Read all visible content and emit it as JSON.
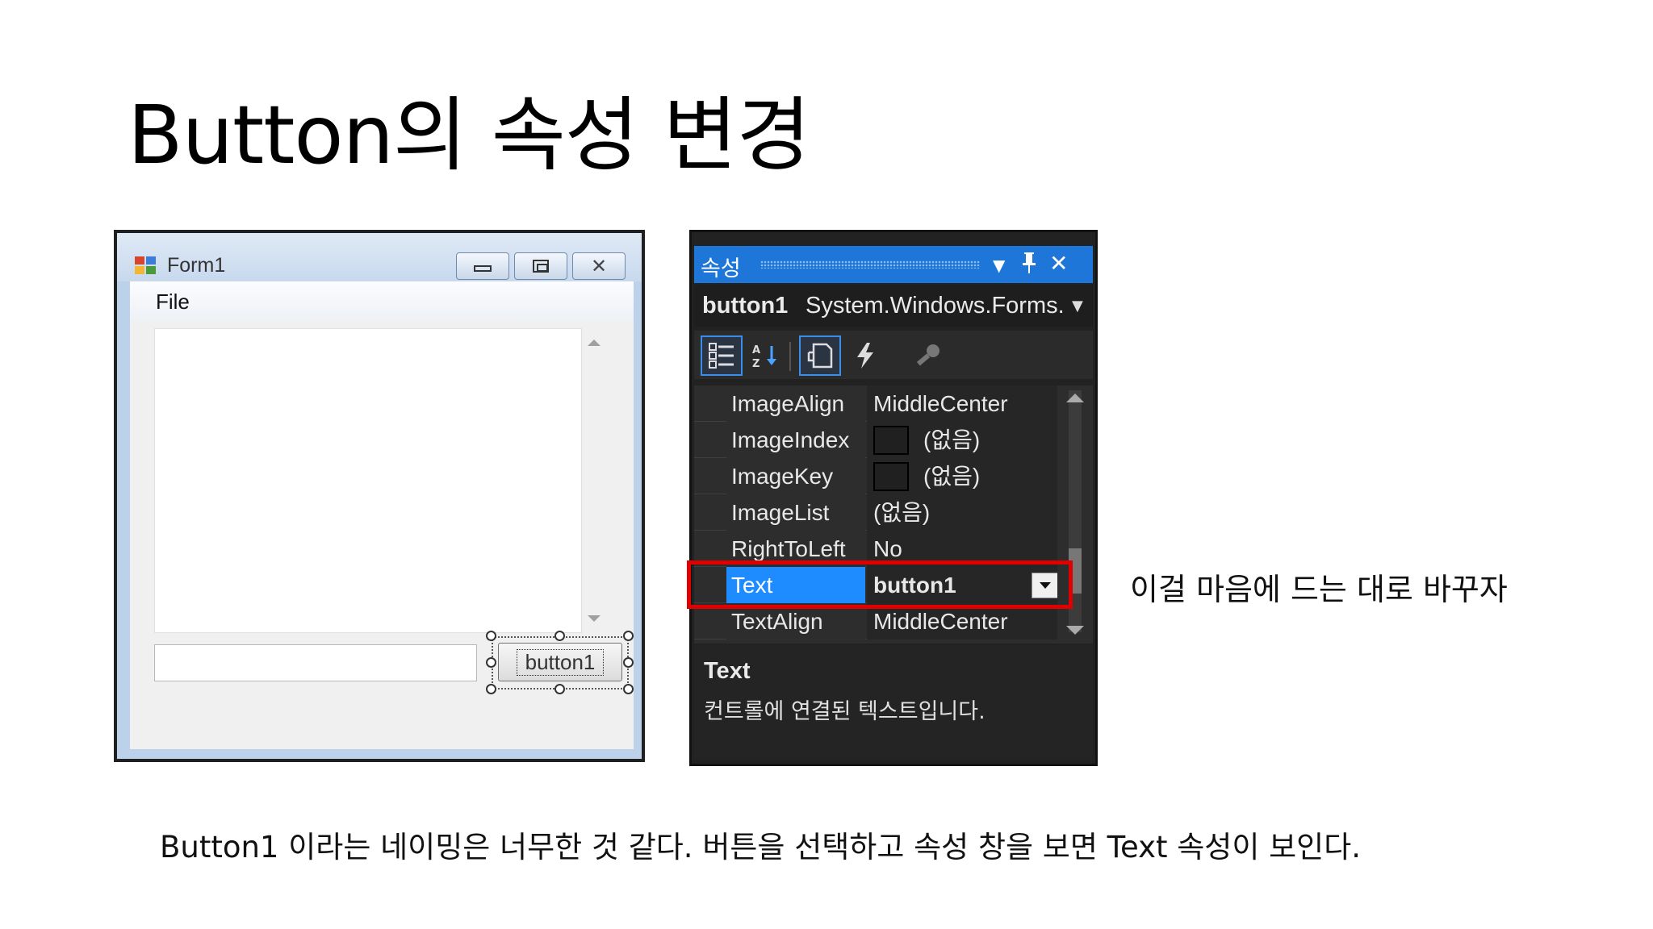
{
  "slide": {
    "title": "Button의 속성 변경",
    "side_note": "이걸 마음에 드는 대로 바꾸자",
    "caption": "Button1 이라는 네이밍은 너무한 것 같다. 버튼을 선택하고 속성 창을 보면 Text 속성이 보인다."
  },
  "form_window": {
    "title": "Form1",
    "menu_file": "File",
    "button_label": "button1",
    "icons": {
      "app": "form-app-icon",
      "minimize": "minimize-icon",
      "maximize": "maximize-icon",
      "close": "close-icon"
    }
  },
  "properties_panel": {
    "title": "속성",
    "object_name": "button1",
    "object_type": "System.Windows.Forms.",
    "toolbar_icons": [
      "categorized-icon",
      "alphabetical-icon",
      "properties-icon",
      "events-icon",
      "property-pages-icon"
    ],
    "rows": [
      {
        "name": "ImageAlign",
        "value": "MiddleCenter"
      },
      {
        "name": "ImageIndex",
        "value": "(없음)"
      },
      {
        "name": "ImageKey",
        "value": "(없음)"
      },
      {
        "name": "ImageList",
        "value": "(없음)"
      },
      {
        "name": "RightToLeft",
        "value": "No"
      },
      {
        "name": "Text",
        "value": "button1"
      },
      {
        "name": "TextAlign",
        "value": "MiddleCenter"
      }
    ],
    "description_title": "Text",
    "description_text": "컨트롤에 연결된 텍스트입니다.",
    "highlight_color": "#e00000",
    "selection_color": "#1e8cff"
  }
}
